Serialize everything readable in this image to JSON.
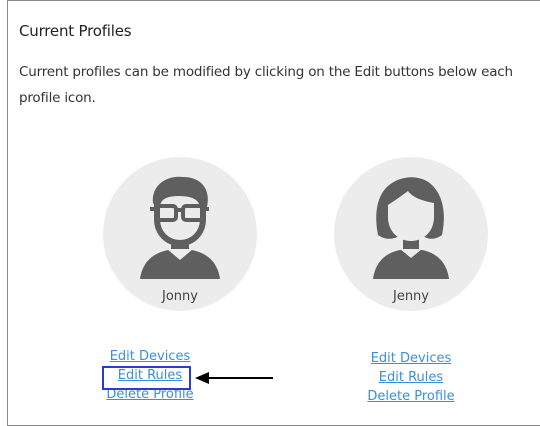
{
  "section": {
    "title": "Current Profiles",
    "description": "Current profiles can be modified by clicking on the Edit buttons below each profile icon."
  },
  "profiles": [
    {
      "name": "Jonny",
      "icon": "boy-with-glasses-avatar-icon",
      "links": {
        "edit_devices": "Edit Devices",
        "edit_rules": "Edit Rules",
        "delete_profile": "Delete Profile"
      }
    },
    {
      "name": "Jenny",
      "icon": "girl-avatar-icon",
      "links": {
        "edit_devices": "Edit Devices",
        "edit_rules": "Edit Rules",
        "delete_profile": "Delete Profile"
      }
    }
  ],
  "annotation": {
    "highlight_color": "#2b3bd1",
    "arrow_color": "#000000"
  },
  "colors": {
    "link": "#3a8fd8",
    "avatar_bg": "#ececec",
    "avatar_fg": "#5f5f5f"
  }
}
